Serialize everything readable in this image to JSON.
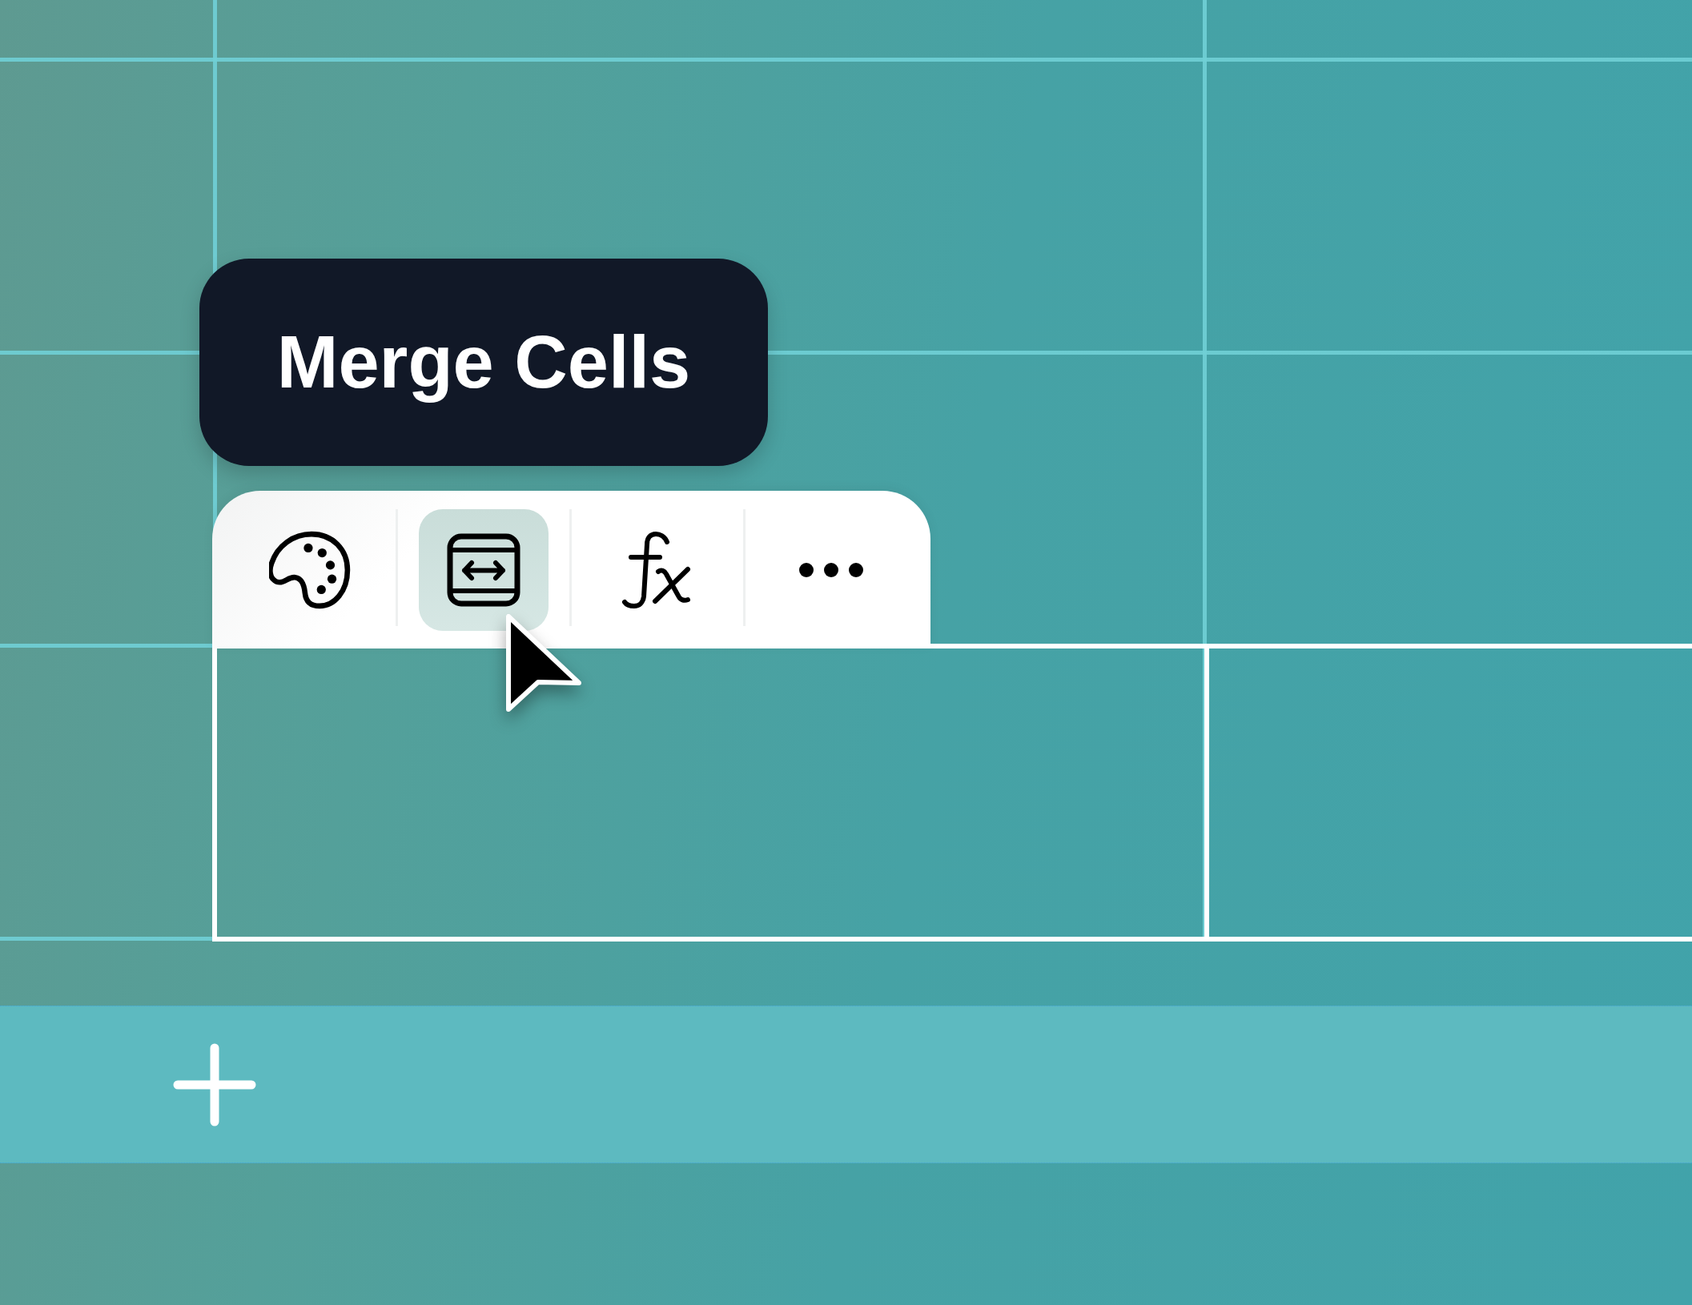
{
  "tooltip": {
    "text": "Merge Cells"
  },
  "toolbar": {
    "buttons": [
      {
        "kind": "palette",
        "selected": false
      },
      {
        "kind": "merge",
        "selected": true
      },
      {
        "kind": "function",
        "selected": false
      },
      {
        "kind": "more",
        "selected": false
      }
    ]
  }
}
